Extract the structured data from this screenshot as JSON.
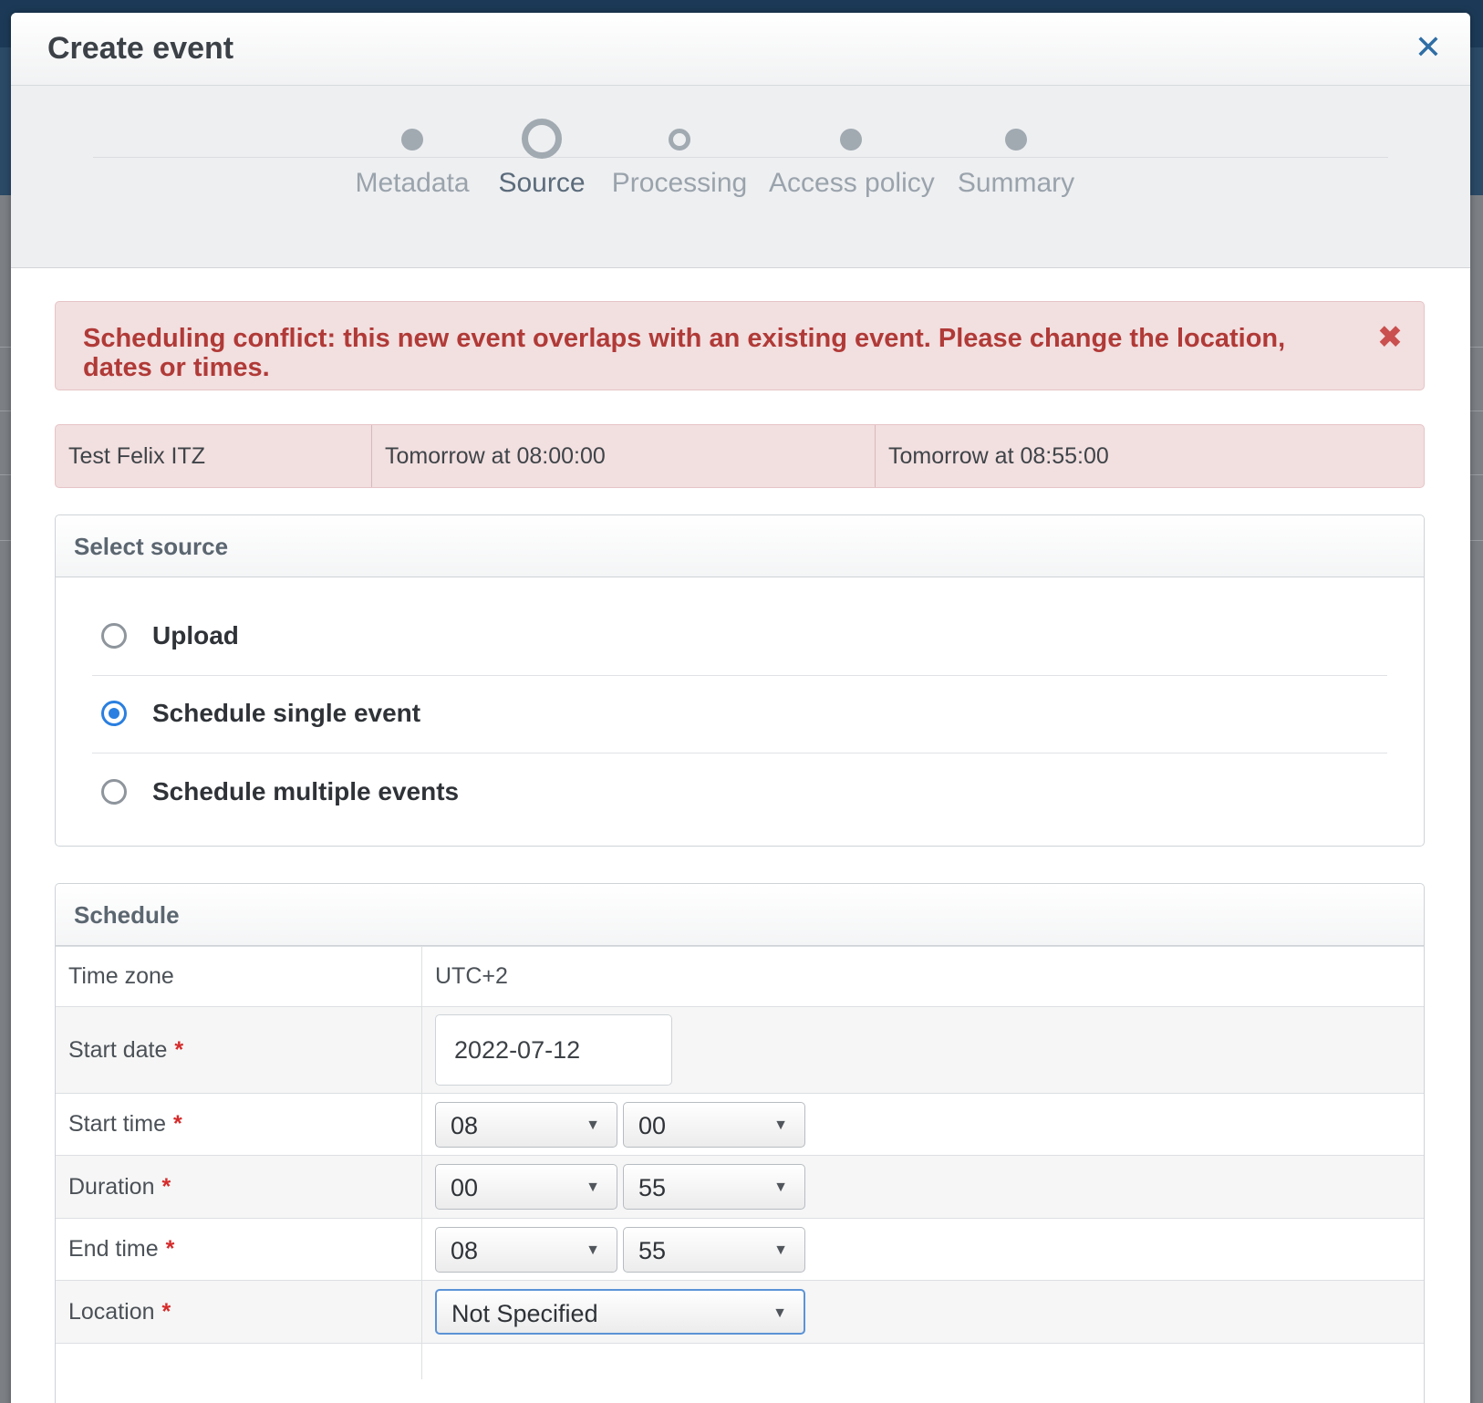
{
  "modal": {
    "title": "Create event",
    "close_icon": "close-icon"
  },
  "wizard": {
    "steps": [
      {
        "label": "Metadata",
        "state": "done"
      },
      {
        "label": "Source",
        "state": "active"
      },
      {
        "label": "Processing",
        "state": "next"
      },
      {
        "label": "Access policy",
        "state": "pending"
      },
      {
        "label": "Summary",
        "state": "pending"
      }
    ]
  },
  "alert": {
    "text": "Scheduling conflict: this new event overlaps with an existing event. Please change the location, dates or times.",
    "color": "#b03a37"
  },
  "conflict": {
    "title": "Test Felix ITZ",
    "start": "Tomorrow at 08:00:00",
    "end": "Tomorrow at 08:55:00"
  },
  "source": {
    "heading": "Select source",
    "options": [
      {
        "label": "Upload",
        "checked": false
      },
      {
        "label": "Schedule single event",
        "checked": true
      },
      {
        "label": "Schedule multiple events",
        "checked": false
      }
    ]
  },
  "schedule": {
    "heading": "Schedule",
    "required_mark": "*",
    "timezone_label": "Time zone",
    "timezone_value": "UTC+2",
    "start_date_label": "Start date",
    "start_date_value": "2022-07-12",
    "start_time_label": "Start time",
    "start_hour": "08",
    "start_minute": "00",
    "duration_label": "Duration",
    "duration_hours": "00",
    "duration_minutes": "55",
    "end_time_label": "End time",
    "end_hour": "08",
    "end_minute": "55",
    "location_label": "Location",
    "location_value": "Not Specified"
  },
  "colors": {
    "accent": "#2a7fe0",
    "close": "#2f6ea5",
    "required": "#d62b2b"
  }
}
